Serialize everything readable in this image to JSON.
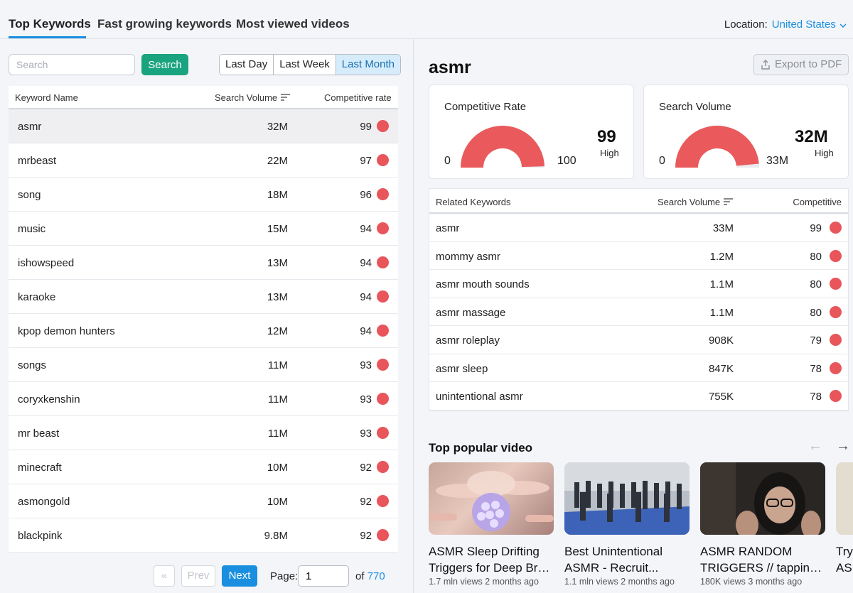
{
  "tabs": [
    {
      "label": "Top Keywords",
      "active": true
    },
    {
      "label": "Fast growing keywords",
      "active": false
    },
    {
      "label": "Most viewed videos",
      "active": false
    }
  ],
  "location": {
    "label": "Location:",
    "value": "United States"
  },
  "search": {
    "placeholder": "Search",
    "value": "",
    "button_label": "Search"
  },
  "periods": [
    {
      "label": "Last Day",
      "active": false
    },
    {
      "label": "Last Week",
      "active": false
    },
    {
      "label": "Last Month",
      "active": true
    }
  ],
  "keyword_table": {
    "columns": [
      "Keyword Name",
      "Search Volume",
      "Competitive rate"
    ],
    "rows": [
      {
        "name": "asmr",
        "volume": "32M",
        "rate": "99"
      },
      {
        "name": "mrbeast",
        "volume": "22M",
        "rate": "97"
      },
      {
        "name": "song",
        "volume": "18M",
        "rate": "96"
      },
      {
        "name": "music",
        "volume": "15M",
        "rate": "94"
      },
      {
        "name": "ishowspeed",
        "volume": "13M",
        "rate": "94"
      },
      {
        "name": "karaoke",
        "volume": "13M",
        "rate": "94"
      },
      {
        "name": "kpop demon hunters",
        "volume": "12M",
        "rate": "94"
      },
      {
        "name": "songs",
        "volume": "11M",
        "rate": "93"
      },
      {
        "name": "coryxkenshin",
        "volume": "11M",
        "rate": "93"
      },
      {
        "name": "mr beast",
        "volume": "11M",
        "rate": "93"
      },
      {
        "name": "minecraft",
        "volume": "10M",
        "rate": "92"
      },
      {
        "name": "asmongold",
        "volume": "10M",
        "rate": "92"
      },
      {
        "name": "blackpink",
        "volume": "9.8M",
        "rate": "92"
      }
    ]
  },
  "pagination": {
    "first_label": "«",
    "prev_label": "Prev",
    "next_label": "Next",
    "page_label": "Page:",
    "page_value": "1",
    "of_label": "of",
    "total_pages": "770"
  },
  "detail": {
    "keyword": "asmr",
    "export_label": "Export to PDF",
    "competitive": {
      "title": "Competitive Rate",
      "min": "0",
      "max": "100",
      "value": "99",
      "level": "High",
      "fill": 0.99
    },
    "volume": {
      "title": "Search Volume",
      "min": "0",
      "max": "33M",
      "value": "32M",
      "level": "High",
      "fill": 0.97
    }
  },
  "related_table": {
    "columns": [
      "Related Keywords",
      "Search Volume",
      "Competitive"
    ],
    "rows": [
      {
        "name": "asmr",
        "volume": "33M",
        "rate": "99"
      },
      {
        "name": "mommy asmr",
        "volume": "1.2M",
        "rate": "80"
      },
      {
        "name": "asmr mouth sounds",
        "volume": "1.1M",
        "rate": "80"
      },
      {
        "name": "asmr massage",
        "volume": "1.1M",
        "rate": "80"
      },
      {
        "name": "asmr roleplay",
        "volume": "908K",
        "rate": "79"
      },
      {
        "name": "asmr sleep",
        "volume": "847K",
        "rate": "78"
      },
      {
        "name": "unintentional asmr",
        "volume": "755K",
        "rate": "78"
      }
    ]
  },
  "videos": {
    "title": "Top popular video",
    "prev_arrow": "←",
    "next_arrow": "→",
    "items": [
      {
        "title": "ASMR Sleep Drifting",
        "title2": "Triggers for Deep Bra...",
        "meta": "1.7 mln views 2 months ago"
      },
      {
        "title": "Best Unintentional",
        "title2": "ASMR - Recruit...",
        "meta": "1.1 mln views 2 months ago"
      },
      {
        "title": "ASMR RANDOM",
        "title2": "TRIGGERS // tapping ...",
        "meta": "180K views 3 months ago"
      },
      {
        "title": "Try",
        "title2": "AS",
        "meta": ""
      }
    ]
  },
  "colors": {
    "accent": "#1a8fe0",
    "green": "#1aa37f",
    "danger": "#e8555b"
  }
}
